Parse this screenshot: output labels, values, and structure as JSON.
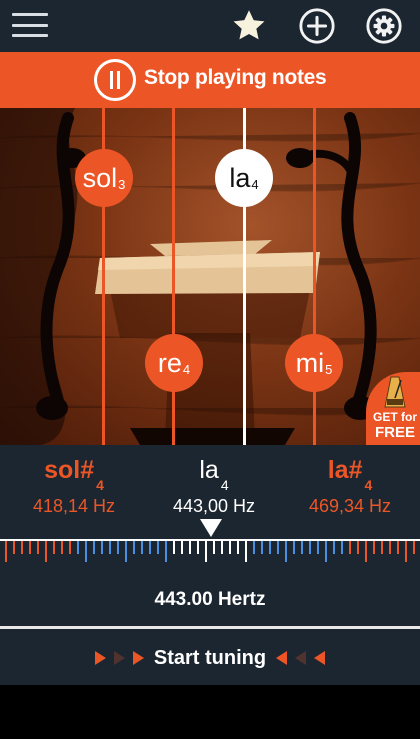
{
  "toolbar": {
    "menu_icon": "hamburger-menu-icon",
    "favorite_icon": "star-icon",
    "add_icon": "plus-circle-icon",
    "settings_icon": "gear-icon"
  },
  "stop_bar": {
    "label": "Stop playing notes",
    "icon": "pause-circle-icon",
    "color": "#ec5627"
  },
  "strings": [
    {
      "note": "sol",
      "octave": "3",
      "active": false
    },
    {
      "note": "re",
      "octave": "4",
      "active": false
    },
    {
      "note": "la",
      "octave": "4",
      "active": true
    },
    {
      "note": "mi",
      "octave": "5",
      "active": false
    }
  ],
  "promo": {
    "line1": "GET for",
    "line2": "FREE",
    "icon": "metronome-icon"
  },
  "tuner": {
    "prev_note": {
      "name": "sol#",
      "octave": "4",
      "freq": "418,14 Hz"
    },
    "current_note": {
      "name": "la",
      "octave": "4",
      "freq": "443,00 Hz"
    },
    "next_note": {
      "name": "la#",
      "octave": "4",
      "freq": "469,34 Hz"
    },
    "hertz_readout": "443.00 Hertz",
    "start_label": "Start tuning"
  },
  "colors": {
    "accent": "#ec5627",
    "panel": "#1c2630",
    "blue_tick": "#4a90e2"
  }
}
